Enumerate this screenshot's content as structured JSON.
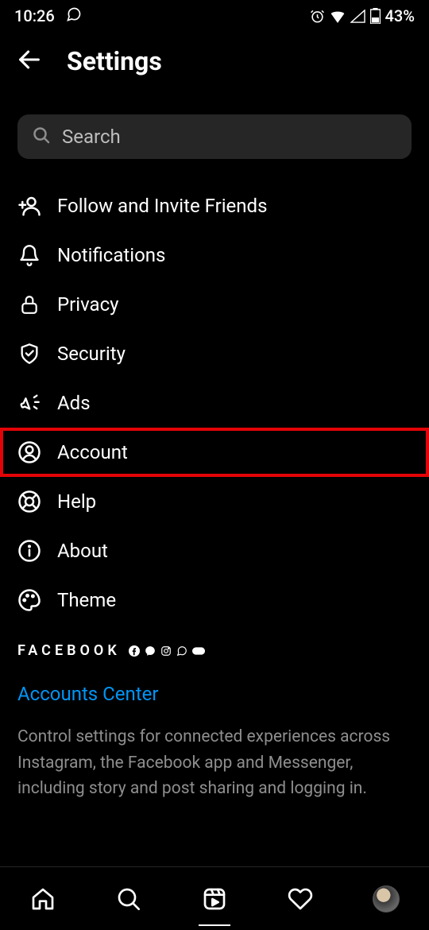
{
  "status": {
    "time": "10:26",
    "battery": "43%"
  },
  "header": {
    "title": "Settings"
  },
  "search": {
    "placeholder": "Search"
  },
  "menu": {
    "items": [
      {
        "label": "Follow and Invite Friends"
      },
      {
        "label": "Notifications"
      },
      {
        "label": "Privacy"
      },
      {
        "label": "Security"
      },
      {
        "label": "Ads"
      },
      {
        "label": "Account"
      },
      {
        "label": "Help"
      },
      {
        "label": "About"
      },
      {
        "label": "Theme"
      }
    ]
  },
  "facebook": {
    "brand": "FACEBOOK",
    "link": "Accounts Center",
    "description": "Control settings for connected experiences across Instagram, the Facebook app and Messenger, including story and post sharing and logging in."
  }
}
